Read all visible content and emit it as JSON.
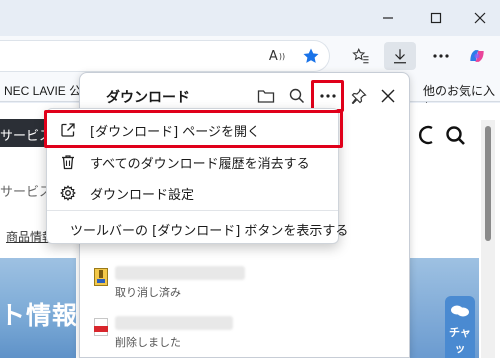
{
  "browser": {
    "read_aloud_label": "A",
    "window_controls": [
      "minimize-icon",
      "maximize-icon",
      "close-icon"
    ]
  },
  "favorites": {
    "left_item": "NEC LAVIE 公式",
    "right_item": "他のお気に入り"
  },
  "page": {
    "service_dark": "サービス",
    "service_light": "サービス",
    "product_info": "商品情報",
    "banner_text": "ト情報",
    "chat_label": "チャッ"
  },
  "downloads": {
    "title": "ダウンロード",
    "items": [
      {
        "status": "取り消し済み",
        "icon": "archive-file-icon"
      },
      {
        "status": "削除しました",
        "icon": "pdf-file-icon"
      }
    ]
  },
  "menu": {
    "items": [
      {
        "label": "[ダウンロード] ページを開く",
        "icon": "open-external-icon"
      },
      {
        "label": "すべてのダウンロード履歴を消去する",
        "icon": "trash-icon"
      },
      {
        "label": "ダウンロード設定",
        "icon": "gear-icon"
      },
      {
        "label": "ツールバーの [ダウンロード] ボタンを表示する",
        "icon": ""
      }
    ]
  },
  "colors": {
    "highlight": "#e0001a",
    "accent": "#1a73e8"
  }
}
